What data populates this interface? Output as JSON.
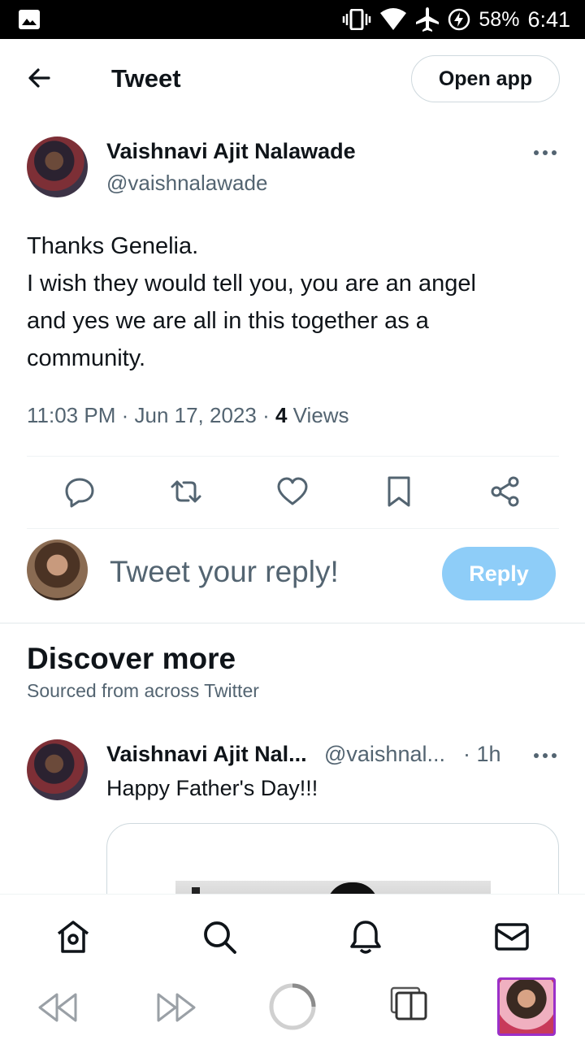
{
  "status_bar": {
    "battery": "58%",
    "time": "6:41"
  },
  "header": {
    "title": "Tweet",
    "open_app_label": "Open app"
  },
  "tweet": {
    "author_name": "Vaishnavi Ajit Nalawade",
    "author_handle": "@vaishnalawade",
    "text_lines": [
      "Thanks Genelia.",
      "I wish they would tell you, you are an angel",
      "and yes we are all in this together as a",
      "community."
    ],
    "time": "11:03 PM",
    "date": "Jun 17, 2023",
    "views_count": "4",
    "views_label": "Views"
  },
  "reply": {
    "placeholder": "Tweet your reply!",
    "button_label": "Reply"
  },
  "discover": {
    "title": "Discover more",
    "subtitle": "Sourced from across Twitter",
    "tweet": {
      "author_name": "Vaishnavi Ajit Nal...",
      "author_handle": "@vaishnal...",
      "time": "· 1h",
      "text": "Happy Father's Day!!!"
    }
  },
  "colors": {
    "accent_light": "#8ecdf8",
    "secondary_text": "#536471",
    "primary_text": "#0f1419",
    "tab_highlight": "#9b30c9"
  },
  "icons": {
    "status_bar": [
      "gallery-icon",
      "vibrate-icon",
      "wifi-icon",
      "airplane-icon",
      "battery-charging-icon"
    ],
    "tweet_actions": [
      "reply-icon",
      "retweet-icon",
      "like-icon",
      "bookmark-icon",
      "share-icon"
    ],
    "bottom_nav": [
      "home-icon",
      "search-icon",
      "notifications-icon",
      "messages-icon"
    ],
    "browser": [
      "rewind-icon",
      "fast-forward-icon",
      "loading-icon",
      "tabs-icon"
    ]
  }
}
